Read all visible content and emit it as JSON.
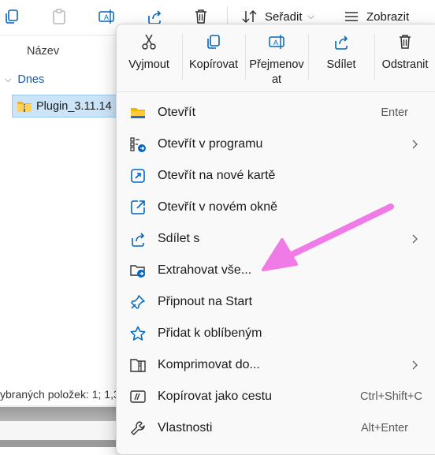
{
  "toolbar": {
    "sort_label": "Seřadit",
    "view_label": "Zobrazit"
  },
  "file_list": {
    "column_name": "Název",
    "group_label": "Dnes",
    "file_name": "Plugin_3.11.14"
  },
  "status_bar": {
    "text": "ybraných položek: 1; 1,3"
  },
  "context_menu": {
    "quick_actions": [
      {
        "label": "Vyjmout",
        "icon": "scissors-icon"
      },
      {
        "label": "Kopírovat",
        "icon": "copy-icon"
      },
      {
        "label": "Přejmenov at",
        "icon": "rename-icon"
      },
      {
        "label": "Sdílet",
        "icon": "share-icon"
      },
      {
        "label": "Odstranit",
        "icon": "trash-icon"
      }
    ],
    "items": [
      {
        "label": "Otevřít",
        "shortcut": "Enter",
        "icon": "folder-icon"
      },
      {
        "label": "Otevřít v programu",
        "shortcut": "",
        "icon": "open-with-icon"
      },
      {
        "label": "Otevřít na nové kartě",
        "shortcut": "",
        "icon": "new-tab-icon"
      },
      {
        "label": "Otevřít v novém okně",
        "shortcut": "",
        "icon": "new-window-icon"
      },
      {
        "label": "Sdílet s",
        "shortcut": "",
        "icon": "share-icon"
      },
      {
        "label": "Extrahovat vše...",
        "shortcut": "",
        "icon": "extract-icon"
      },
      {
        "label": "Připnout na Start",
        "shortcut": "",
        "icon": "pin-icon"
      },
      {
        "label": "Přidat k oblíbeným",
        "shortcut": "",
        "icon": "star-icon"
      },
      {
        "label": "Komprimovat do...",
        "shortcut": "",
        "icon": "zip-icon"
      },
      {
        "label": "Kopírovat jako cestu",
        "shortcut": "Ctrl+Shift+C",
        "icon": "copy-path-icon"
      },
      {
        "label": "Vlastnosti",
        "shortcut": "Alt+Enter",
        "icon": "wrench-icon"
      }
    ]
  },
  "colors": {
    "accent_blue": "#0067c0",
    "annotation_arrow": "#f07ae6",
    "selection": "#cce4f7",
    "folder_yellow": "#f4b400"
  }
}
